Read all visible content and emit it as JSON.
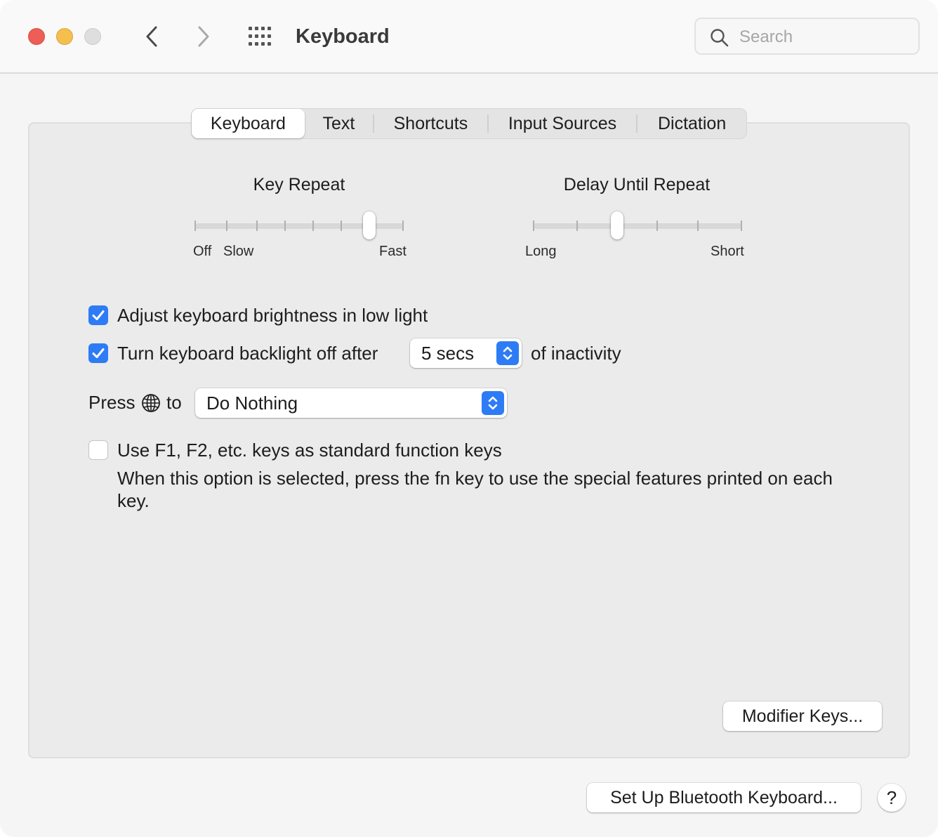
{
  "window": {
    "title": "Keyboard"
  },
  "search": {
    "placeholder": "Search",
    "value": ""
  },
  "tabs": [
    "Keyboard",
    "Text",
    "Shortcuts",
    "Input Sources",
    "Dictation"
  ],
  "selected_tab": "Keyboard",
  "key_repeat": {
    "title": "Key Repeat",
    "label_off": "Off",
    "label_slow": "Slow",
    "label_fast": "Fast",
    "value_fraction": 0.86
  },
  "delay_until_repeat": {
    "title": "Delay Until Repeat",
    "label_long": "Long",
    "label_short": "Short",
    "value_fraction": 0.4
  },
  "brightness": {
    "label": "Adjust keyboard brightness in low light",
    "checked": true
  },
  "backlight": {
    "label": "Turn keyboard backlight off after",
    "checked": true,
    "selected": "5 secs",
    "suffix": "of inactivity"
  },
  "press_globe": {
    "prefix": "Press",
    "suffix": "to",
    "selected": "Do Nothing"
  },
  "function_keys": {
    "label": "Use F1, F2, etc. keys as standard function keys",
    "checked": false,
    "description": "When this option is selected, press the fn key to use the special features printed on each key."
  },
  "buttons": {
    "modifier_keys": "Modifier Keys...",
    "bluetooth": "Set Up Bluetooth Keyboard...",
    "help": "?"
  },
  "colors": {
    "accent": "#2d7cf6",
    "close": "#ee5e57",
    "minimize": "#f5bf4f"
  }
}
